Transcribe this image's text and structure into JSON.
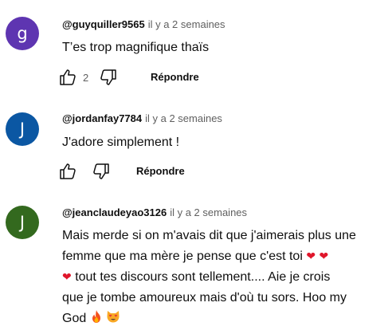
{
  "comments": [
    {
      "avatar_letter": "g",
      "avatar_color": "#5e35b1",
      "author": "@guyquiller9565",
      "time": "il y a 2 semaines",
      "text": "T’es trop magnifique thaïs",
      "likes": "2",
      "reply_label": "Répondre"
    },
    {
      "avatar_letter": "J",
      "avatar_color": "#0b57a3",
      "author": "@jordanfay7784",
      "time": "il y a 2 semaines",
      "text": "J'adore simplement !",
      "likes": "",
      "reply_label": "Répondre"
    },
    {
      "avatar_letter": "J",
      "avatar_color": "#33691e",
      "author": "@jeanclaudeyao3126",
      "time": "il y a 2 semaines",
      "text_parts": {
        "line1": "Mais merde si on m'avais dit que j'aimerais plus une",
        "line2": "femme que ma mère je pense que c'est toi",
        "line3": "tout tes discours sont tellement.... Aie je crois",
        "line4": "que je tombe amoureux mais d'où tu sors. Hoo my",
        "line5": "God"
      },
      "emojis": {
        "heart": "❤",
        "fire": "fire-emoji",
        "cat": "heart-eyes-cat-emoji"
      }
    }
  ],
  "icons": {
    "like": "thumb-up-icon",
    "dislike": "thumb-down-icon"
  }
}
